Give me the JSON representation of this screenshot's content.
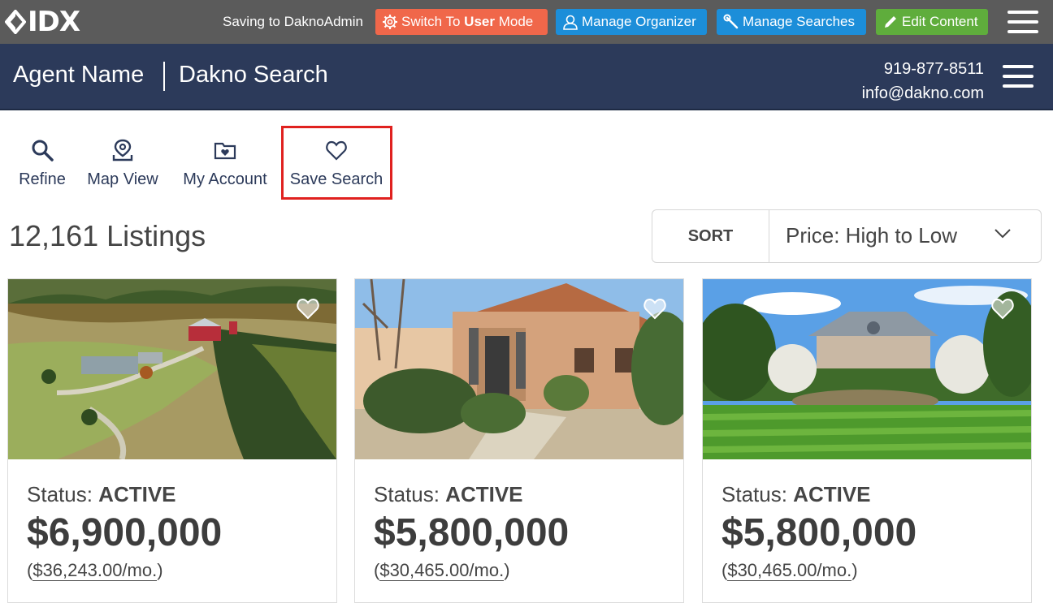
{
  "admin_bar": {
    "logo": "IDX",
    "saving_text": "Saving to DaknoAdmin",
    "switch_mode": {
      "prefix": "Switch To ",
      "bold": "User",
      "suffix": " Mode"
    },
    "manage_organizer": "Manage Organizer",
    "manage_searches": "Manage Searches",
    "edit_content": "Edit Content"
  },
  "header": {
    "agent_name": "Agent Name",
    "site_title": "Dakno Search",
    "phone": "919-877-8511",
    "email": "info@dakno.com"
  },
  "toolbar": {
    "refine": "Refine",
    "map_view": "Map View",
    "my_account": "My Account",
    "save_search": "Save Search"
  },
  "listings": {
    "count": "12,161 Listings",
    "sort_label": "SORT",
    "sort_value": "Price: High to Low"
  },
  "cards": [
    {
      "status_label": "Status:",
      "status": "ACTIVE",
      "price": "$6,900,000",
      "monthly": "$36,243.00/mo."
    },
    {
      "status_label": "Status:",
      "status": "ACTIVE",
      "price": "$5,800,000",
      "monthly": "$30,465.00/mo."
    },
    {
      "status_label": "Status:",
      "status": "ACTIVE",
      "price": "$5,800,000",
      "monthly": "$30,465.00/mo."
    }
  ],
  "colors": {
    "admin_bar": "#5b5b5b",
    "header": "#2c3a5a",
    "switch_button": "#f0674a",
    "blue_button": "#1c8ed9",
    "green_button": "#5fad3c",
    "highlight": "#e0211f"
  },
  "icons": [
    "idx-logo-icon",
    "gear-icon",
    "user-icon",
    "wrench-icon",
    "pencil-icon",
    "hamburger-icon",
    "search-icon",
    "map-pin-icon",
    "folder-icon",
    "heart-icon",
    "chevron-down-icon"
  ]
}
